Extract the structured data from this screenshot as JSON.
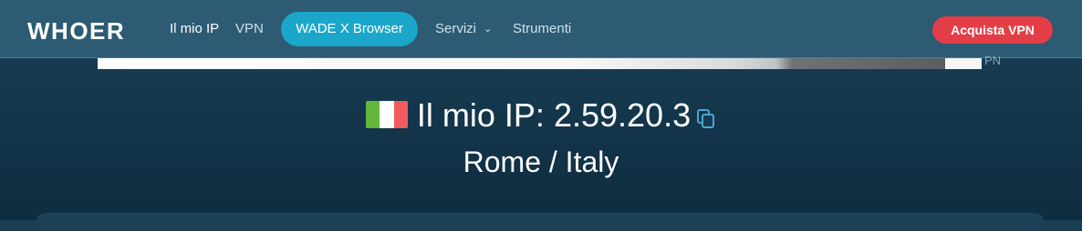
{
  "nav": {
    "logo": "WHOER",
    "links": [
      {
        "label": "Il mio IP"
      },
      {
        "label": "VPN"
      },
      {
        "label": "Servizi"
      },
      {
        "label": "Strumenti"
      }
    ],
    "wade_button": "WADE X Browser",
    "buy_button": "Acquista VPN"
  },
  "banner": {
    "overflow_text": "PN"
  },
  "ip_info": {
    "label": "Il mio IP:",
    "ip": "2.59.20.3",
    "country_flag": "italy-flag",
    "location": "Rome / Italy"
  },
  "colors": {
    "nav_bg": "#2c5b73",
    "accent": "#1aa7c9",
    "buy": "#e33e47",
    "page_bg": "#143549"
  }
}
